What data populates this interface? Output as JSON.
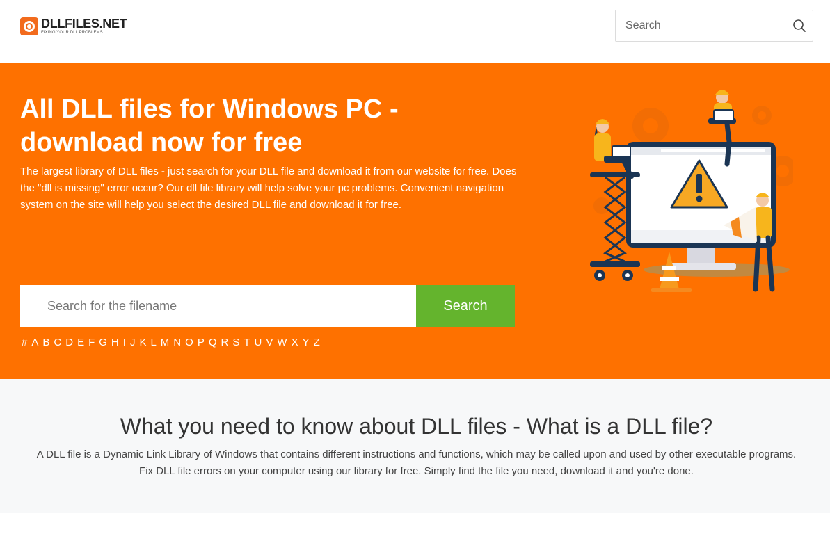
{
  "header": {
    "logo_name": "DLLFILES.NET",
    "logo_tagline": "FIXING YOUR DLL PROBLEMS",
    "search_placeholder": "Search"
  },
  "hero": {
    "title": "All DLL files for Windows PC - download now for free",
    "description": "The largest library of DLL files - just search for your DLL file and download it from our website for free. Does the \"dll is missing\" error occur? Our dll file library will help solve your pc problems. Convenient navigation system on the site will help you select the desired DLL file and download it for free.",
    "search_placeholder": "Search for the filename",
    "search_button": "Search",
    "alphabet": [
      "#",
      "A",
      "B",
      "C",
      "D",
      "E",
      "F",
      "G",
      "H",
      "I",
      "J",
      "K",
      "L",
      "M",
      "N",
      "O",
      "P",
      "Q",
      "R",
      "S",
      "T",
      "U",
      "V",
      "W",
      "X",
      "Y",
      "Z"
    ]
  },
  "info": {
    "heading": "What you need to know about DLL files - What is a DLL file?",
    "text": "A DLL file is a Dynamic Link Library of Windows that contains different instructions and functions, which may be called upon and used by other executable programs. Fix DLL file errors on your computer using our library for free. Simply find the file you need, download it and you're done."
  },
  "colors": {
    "brand_orange": "#fe7100",
    "search_green": "#64b42d",
    "info_bg": "#f7f8f9"
  },
  "icons": {
    "logo": "dllfiles-logo-icon",
    "search": "search-icon",
    "illustration": "workers-fixing-computer-warning-illustration"
  }
}
